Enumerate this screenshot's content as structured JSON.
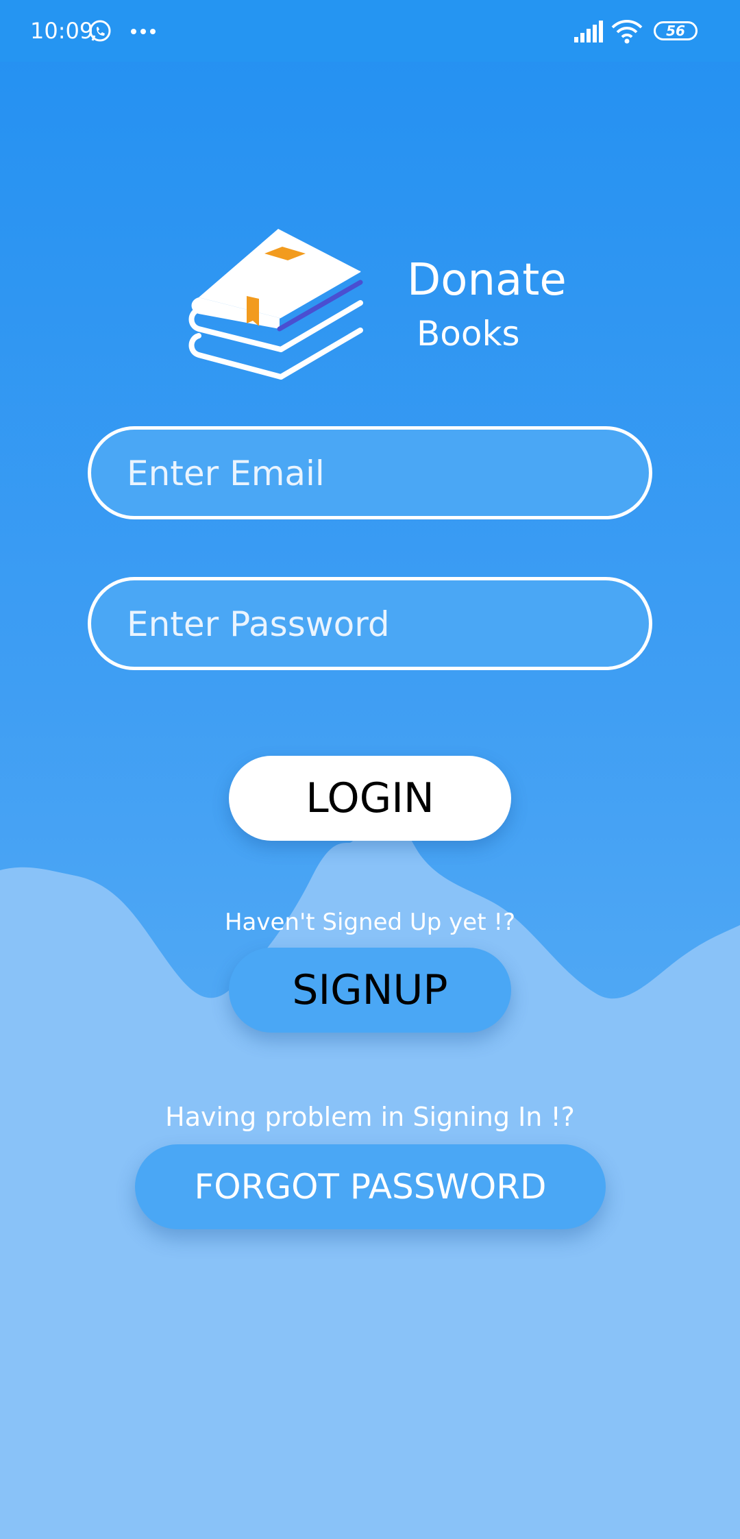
{
  "status_bar": {
    "time": "10:09",
    "battery_level": "56",
    "icons": [
      "whatsapp-icon",
      "more-dots-icon",
      "signal-icon",
      "wifi-icon",
      "battery-icon"
    ]
  },
  "brand": {
    "title": "Donate",
    "subtitle": "Books",
    "logo_icon": "books-stack-icon"
  },
  "form": {
    "email_placeholder": "Enter Email",
    "email_value": "",
    "password_placeholder": "Enter Password",
    "password_value": ""
  },
  "actions": {
    "login_label": "LOGIN",
    "signup_hint": "Haven't Signed Up yet !?",
    "signup_label": "SIGNUP",
    "forgot_hint": "Having problem in Signing In !?",
    "forgot_label": "FORGOT PASSWORD"
  },
  "colors": {
    "primary_blue": "#2390f2",
    "field_blue": "#4aa7f5",
    "light_blue": "#89c2f8",
    "accent_orange": "#f29b1e",
    "accent_indigo": "#4a4fd1"
  }
}
